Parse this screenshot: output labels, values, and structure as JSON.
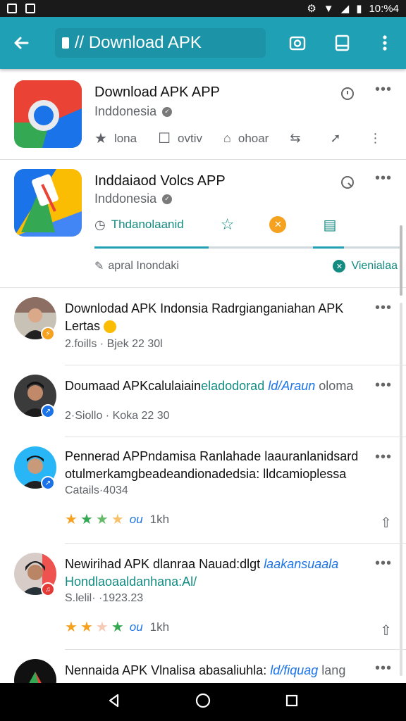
{
  "status_bar": {
    "time": "10:%4"
  },
  "toolbar": {
    "back_icon": "arrow-left-icon",
    "url_text": "// Download APK",
    "camera_icon": "camera-icon",
    "tabs_icon": "tabs-icon",
    "menu_icon": "overflow-menu-icon"
  },
  "apps": [
    {
      "title": "Download APK APP",
      "subtitle": "Inddonesia",
      "actions": [
        {
          "icon": "star-icon",
          "label": "lona"
        },
        {
          "icon": "square-icon",
          "label": "ovtiv"
        },
        {
          "icon": "bookmark-icon",
          "label": "ohoar"
        }
      ]
    },
    {
      "title": "Inddaiaod Volcs APP",
      "subtitle": "Inddonesia",
      "tab_active_label": "Thdanolaanid",
      "secondary_left": "apral Inondaki",
      "secondary_right": "Vienialaa"
    }
  ],
  "posts": [
    {
      "text_main": "Downlodad APK Indonsia Radrgianganiahan APK",
      "text_second": "Lertas",
      "meta": "2.foills · Bjek 22 30l",
      "badge_color": "#f4a21f"
    },
    {
      "text_main": "Doumaad APKcalulaiain",
      "text_green": "eladodorad",
      "text_link": "ld/Araun",
      "text_tail": "oloma",
      "meta": "2·Siollo · Koka 22 30",
      "badge_color": "#1a73e8"
    },
    {
      "text_main": "Pennerad APPndamisa Ranlahade laauranlanidsard",
      "text_second": "otulmerkamgbeadeandionadedsia: lldcamioplessa",
      "meta": "Catails·4034",
      "rating_label": "ou",
      "rating_count": "1kh",
      "badge_color": "#1a73e8"
    },
    {
      "text_main": "Newirihad APK dlanraa Nauad:dlgt",
      "text_link": "laakansuaala",
      "text_green": "Hondlaoaaldanhana:Al/",
      "meta": "S.lelil· ·1923.23",
      "rating_label": "ou",
      "rating_count": "1kh",
      "badge_color": "#e53935"
    },
    {
      "text_main": "Nennaida APK Vlnalisa abasaliuhla:",
      "text_link": "ld/fiquag",
      "text_tail": "lang"
    }
  ],
  "colors": {
    "app_bar": "#1fa0b4",
    "accent_green": "#138b80",
    "star": "#f4a21f"
  }
}
